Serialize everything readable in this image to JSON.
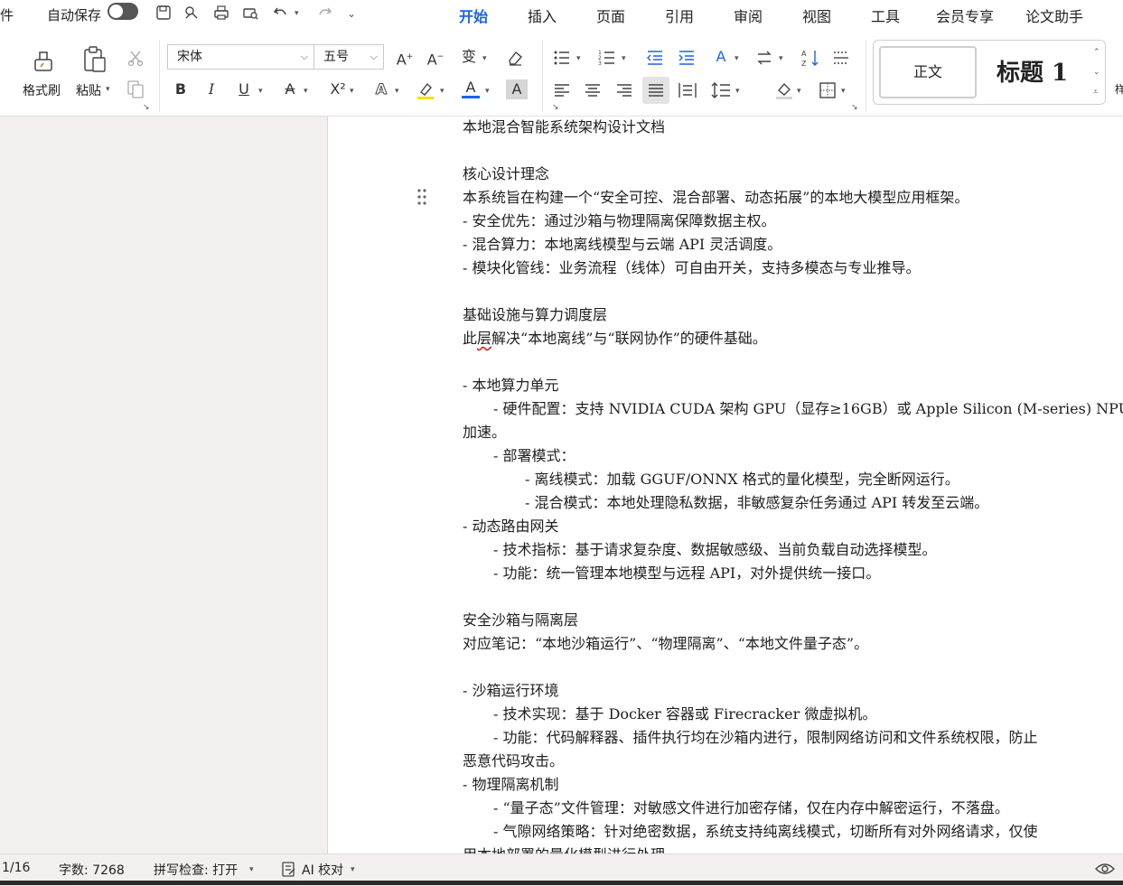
{
  "topbar": {
    "file_partial": "件",
    "autosave_label": "自动保存",
    "autosave_on": false,
    "tabs": [
      {
        "label": "开始",
        "active": true
      },
      {
        "label": "插入"
      },
      {
        "label": "页面"
      },
      {
        "label": "引用"
      },
      {
        "label": "审阅"
      },
      {
        "label": "视图"
      },
      {
        "label": "工具"
      },
      {
        "label": "会员专享"
      },
      {
        "label": "论文助手"
      }
    ]
  },
  "ribbon": {
    "format_painter": "格式刷",
    "paste": "粘贴",
    "font_name": "宋体",
    "font_size": "五号",
    "style_normal": "正文",
    "style_heading1": "标题 1",
    "bold": "B",
    "italic": "I",
    "underline": "U",
    "superscript": "X²",
    "accent_color": "#1664f5"
  },
  "document": {
    "lines": [
      "本地混合智能系统架构设计文档",
      "核心设计理念",
      "本系统旨在构建一个“安全可控、混合部署、动态拓展”的本地大模型应用框架。",
      "-  安全优先：通过沙箱与物理隔离保障数据主权。",
      "-  混合算力：本地离线模型与云端 API 灵活调度。",
      "-  模块化管线：业务流程（线体）可自由开关，支持多模态与专业推导。",
      "基础设施与算力调度层",
      "此",
      "层",
      "解决“本地离线”与“联网协作”的硬件基础。",
      "-  本地算力单元",
      "-  硬件配置：支持 NVIDIA CUDA 架构 GPU（显存≥16GB）或 Apple Silicon (M-series) NPU",
      "加速。",
      "-  部署模式：",
      "-  离线模式：加载 GGUF/ONNX 格式的量化模型，完全断网运行。",
      "-  混合模式：本地处理隐私数据，非敏感复杂任务通过 API 转发至云端。",
      "-  动态路由网关",
      "-  技术指标：基于请求复杂度、数据敏感级、当前负载自动选择模型。",
      "-  功能：统一管理本地模型与远程 API，对外提供统一接口。",
      "安全沙箱与隔离层",
      "对应笔记：“本地沙箱运行”、“物理隔离”、“本地文件量子态”。",
      "-  沙箱运行环境",
      "-  技术实现：基于 Docker 容器或 Firecracker 微虚拟机。",
      "-  功能：代码解释器、插件执行均在沙箱内进行，限制网络访问和文件系统权限，防止",
      "恶意代码攻击。",
      "-  物理隔离机制",
      "- “量子态”文件管理：对敏感文件进行加密存储，仅在内存中解密运行，不落盘。",
      "-  气隙网络策略：针对绝密数据，系统支持纯离线模式，切断所有对外网络请求，仅使",
      "用本地部署的量化模型进行处理。"
    ]
  },
  "statusbar": {
    "page": "1/16",
    "word_count": "字数: 7268",
    "spell_check": "拼写检查: 打开",
    "ai_check": "AI 校对"
  }
}
